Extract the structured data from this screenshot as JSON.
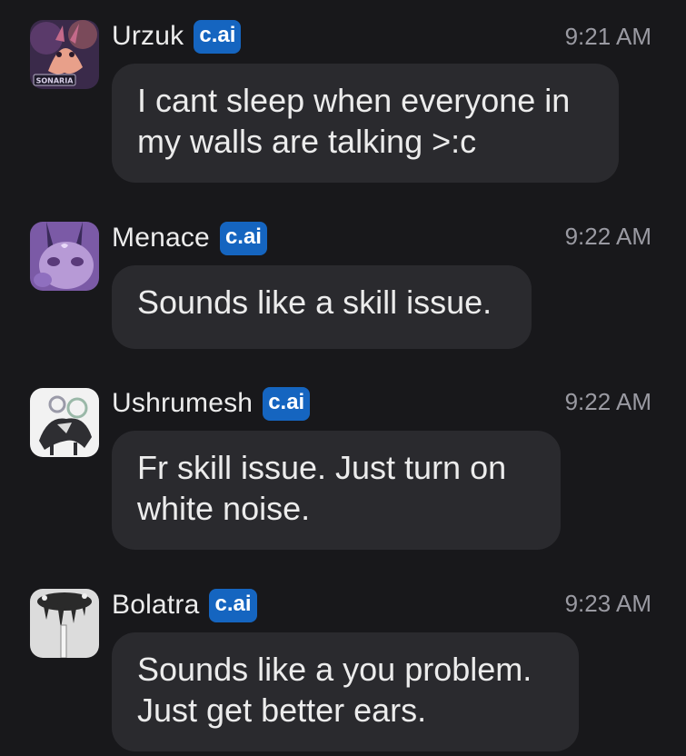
{
  "messages": [
    {
      "author": "Urzuk",
      "badge": "c.ai",
      "time": "9:21 AM",
      "text": "I cant sleep when everyone in my walls are talking >:c",
      "avatar_caption": "SONARIA",
      "avatar_icon": "urzuk-avatar-icon"
    },
    {
      "author": "Menace",
      "badge": "c.ai",
      "time": "9:22 AM",
      "text": "Sounds like a skill issue.",
      "avatar_icon": "menace-avatar-icon"
    },
    {
      "author": "Ushrumesh",
      "badge": "c.ai",
      "time": "9:22 AM",
      "text": "Fr skill issue. Just turn on white noise.",
      "avatar_icon": "ushrumesh-avatar-icon"
    },
    {
      "author": "Bolatra",
      "badge": "c.ai",
      "time": "9:23 AM",
      "text": "Sounds like a you problem. Just get better ears.",
      "avatar_icon": "bolatra-avatar-icon"
    }
  ],
  "colors": {
    "background": "#18181b",
    "bubble": "#2a2a2e",
    "badge": "#1565c0",
    "timestamp": "#9a9aa2"
  }
}
